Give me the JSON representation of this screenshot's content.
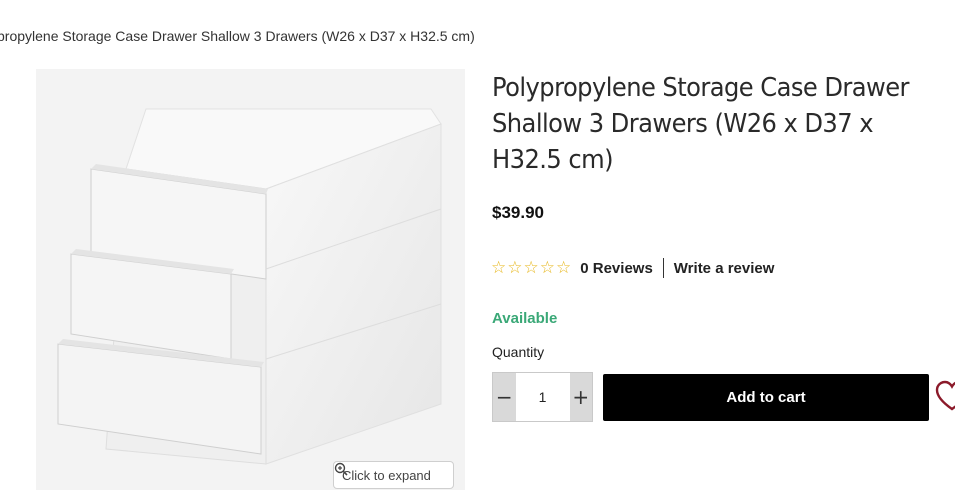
{
  "breadcrumb": {
    "current": "propylene Storage Case Drawer Shallow 3 Drawers (W26 x D37 x H32.5 cm)"
  },
  "product": {
    "title": "Polypropylene Storage Case Drawer Shallow 3 Drawers (W26 x D37 x H32.5 cm)",
    "price": "$39.90",
    "rating": 0,
    "reviews_label": "0 Reviews",
    "write_review_label": "Write a review",
    "availability": "Available"
  },
  "gallery": {
    "expand_label": "Click to expand",
    "expand_icon": "zoom-icon"
  },
  "purchase": {
    "quantity_label": "Quantity",
    "quantity_value": "1",
    "decrement_symbol": "−",
    "increment_symbol": "+",
    "add_to_cart_label": "Add to cart"
  },
  "icons": {
    "star": "star-outline-icon",
    "wishlist": "heart-icon"
  },
  "colors": {
    "available": "#3aa877",
    "star": "#e8b923",
    "cart_button": "#000000",
    "wishlist": "#8b1a2a"
  }
}
